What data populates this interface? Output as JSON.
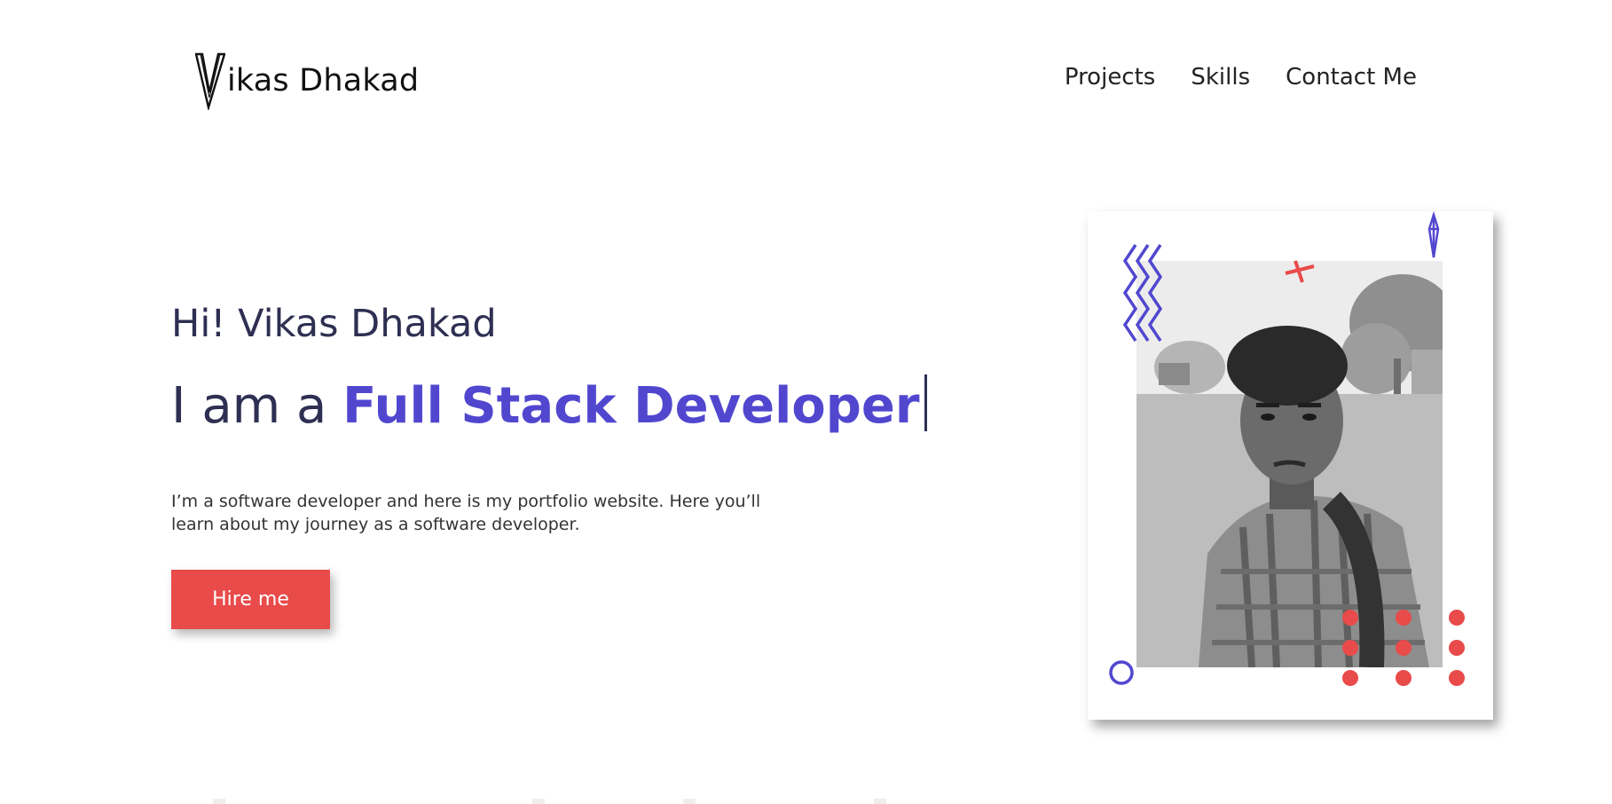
{
  "header": {
    "logo_text": "ikas Dhakad",
    "nav": [
      "Projects",
      "Skills",
      "Contact Me"
    ]
  },
  "hero": {
    "greeting": "Hi! Vikas Dhakad",
    "prefix": "I am a ",
    "role": "Full Stack Developer",
    "description": "I’m a software developer and here is my portfolio website. Here you’ll learn about my journey as a software developer.",
    "cta": "Hire me"
  },
  "colors": {
    "accent": "#5147cf",
    "cta": "#e94a4a",
    "heading": "#2e2f52"
  },
  "icons": [
    "logo-v-icon",
    "zigzag-icon",
    "cross-icon",
    "crystal-icon",
    "ring-icon",
    "dot-grid-icon"
  ]
}
